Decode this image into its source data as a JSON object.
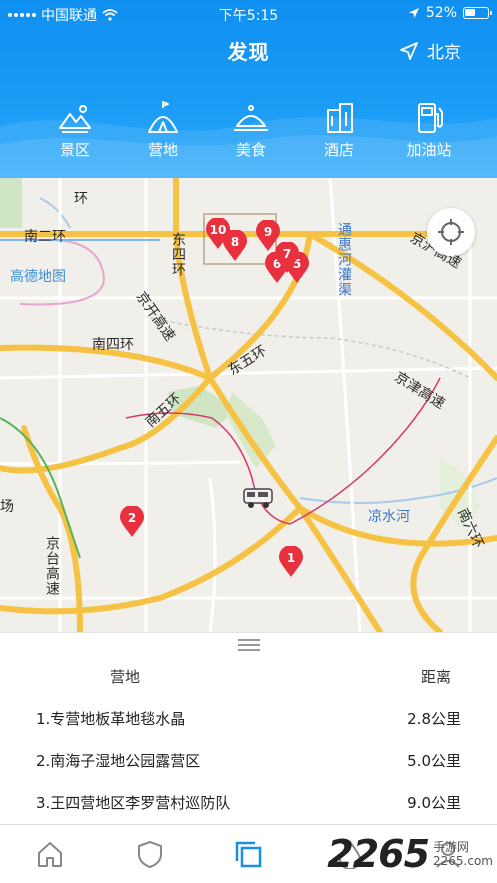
{
  "status_bar": {
    "carrier": "中国联通",
    "time": "下午5:15",
    "battery": "52%",
    "battery_level": 0.52
  },
  "header": {
    "title": "发现",
    "city": "北京"
  },
  "categories": [
    {
      "label": "景区",
      "icon": "mountain-icon"
    },
    {
      "label": "营地",
      "icon": "tent-icon"
    },
    {
      "label": "美食",
      "icon": "food-cloche-icon"
    },
    {
      "label": "酒店",
      "icon": "hotel-icon"
    },
    {
      "label": "加油站",
      "icon": "gas-station-icon"
    }
  ],
  "map": {
    "labels": {
      "ring2": "南二环",
      "brand": "高德地图",
      "ring4": "南四环",
      "ring5_east": "东五环",
      "ring5_south": "南五环",
      "ring4_east": "东四环",
      "jingkai": "京开高速",
      "jinghu": "京沪高速",
      "jingjin": "京津高速",
      "tonghui": "通惠河灌渠",
      "liangshui": "凉水河",
      "jingtai": "京台高速",
      "south6": "南六环",
      "airport": "场",
      "ring_top": "环"
    },
    "markers": [
      "10",
      "8",
      "9",
      "7",
      "6",
      "5",
      "2",
      "1"
    ]
  },
  "list": {
    "col_name": "营地",
    "col_distance": "距离",
    "rows": [
      {
        "name": "1.专营地板革地毯水晶",
        "distance": "2.8公里"
      },
      {
        "name": "2.南海子湿地公园露营区",
        "distance": "5.0公里"
      },
      {
        "name": "3.王四营地区李罗营村巡防队",
        "distance": "9.0公里"
      }
    ]
  },
  "tabbar": {
    "tabs": [
      "home-icon",
      "shield-icon",
      "discover-icon",
      "drop-icon",
      "profile-icon"
    ]
  },
  "watermark": {
    "big": "2265",
    "site": "手游网",
    "domain": "2265.com"
  },
  "colors": {
    "header_blue": "#1a9bf5",
    "pin_red": "#e8303f",
    "active_tab": "#1a8fe8"
  }
}
